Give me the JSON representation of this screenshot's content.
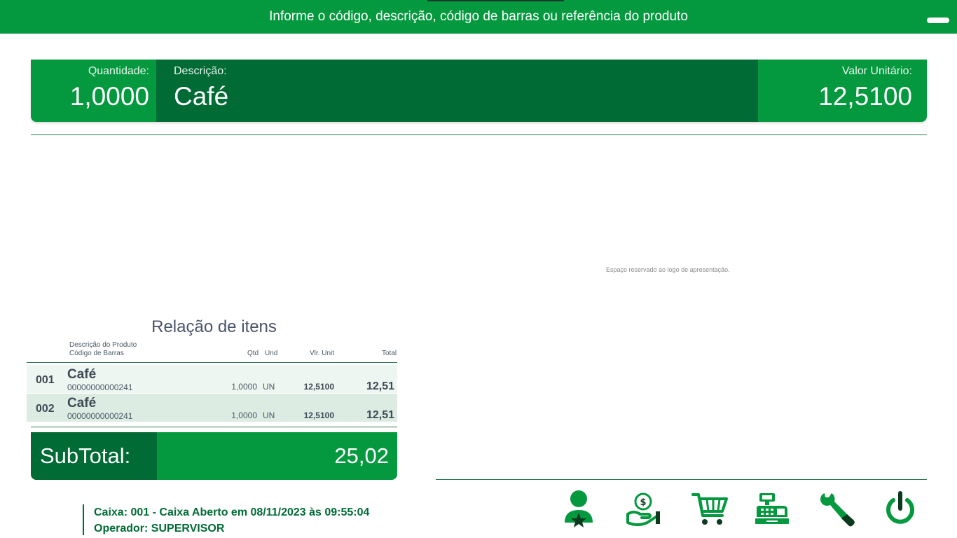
{
  "header": {
    "prompt": "Informe o código, descrição, código de barras ou referência do produto"
  },
  "product": {
    "quantity_label": "Quantidade:",
    "quantity_value": "1,0000",
    "description_label": "Descrição:",
    "description_value": "Café",
    "unit_price_label": "Valor Unitário:",
    "unit_price_value": "12,5100"
  },
  "logo_placeholder": "Espaço reservado ao logo de apresentação.",
  "items": {
    "title": "Relação de itens",
    "columns": {
      "description": "Descrição do Produto",
      "barcode": "Código de Barras",
      "qty": "Qtd",
      "unit": "Und",
      "unit_price": "Vlr. Unit",
      "total": "Total"
    },
    "rows": [
      {
        "num": "001",
        "name": "Café",
        "code": "00000000000241",
        "qty": "1,0000",
        "unit": "UN",
        "unit_price": "12,5100",
        "total": "12,51"
      },
      {
        "num": "002",
        "name": "Café",
        "code": "00000000000241",
        "qty": "1,0000",
        "unit": "UN",
        "unit_price": "12,5100",
        "total": "12,51"
      }
    ]
  },
  "subtotal": {
    "label": "SubTotal:",
    "value": "25,02"
  },
  "status": {
    "register": "Caixa: 001 - Caixa Aberto em 08/11/2023 às 09:55:04",
    "operator": "Operador: SUPERVISOR"
  },
  "toolbar_icons": [
    "customer-star-icon",
    "payment-hand-icon",
    "shopping-cart-icon",
    "cash-register-icon",
    "wrench-icon",
    "power-icon"
  ],
  "colors": {
    "primary": "#05993f",
    "dark": "#006b35",
    "row_light": "#eef6f1",
    "row_dark": "#dcece3"
  }
}
